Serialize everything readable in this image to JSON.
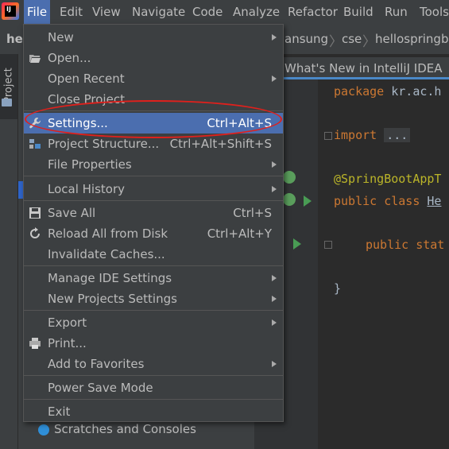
{
  "menubar": {
    "items": [
      "File",
      "Edit",
      "View",
      "Navigate",
      "Code",
      "Analyze",
      "Refactor",
      "Build",
      "Run",
      "Tools"
    ]
  },
  "breadcrumb": {
    "project": "hel",
    "parts": [
      "ansung",
      "cse",
      "hellospringbo"
    ]
  },
  "project_panel": {
    "tab_label": "Project",
    "scratches_label": "Scratches and Consoles"
  },
  "editor": {
    "tab_title": "What's New in IntelliJ IDEA",
    "lines": {
      "package_kw": "package",
      "package_name": " kr.ac.h",
      "import_kw": "import",
      "import_fold": "...",
      "annotation": "@SpringBootAppT",
      "public_kw": "public",
      "class_kw": "class",
      "class_name": "He",
      "public2_kw": "public",
      "static_kw": "stat",
      "brace": "}"
    }
  },
  "file_menu": {
    "items": [
      {
        "label": "New",
        "submenu": true
      },
      {
        "label": "Open...",
        "icon": "folder-open-icon"
      },
      {
        "label": "Open Recent",
        "submenu": true
      },
      {
        "label": "Close Project"
      },
      {
        "label": "Settings...",
        "shortcut": "Ctrl+Alt+S",
        "icon": "wrench-icon",
        "highlighted": true
      },
      {
        "label": "Project Structure...",
        "shortcut": "Ctrl+Alt+Shift+S",
        "icon": "project-structure-icon"
      },
      {
        "label": "File Properties",
        "submenu": true
      },
      {
        "label": "Local History",
        "submenu": true
      },
      {
        "label": "Save All",
        "shortcut": "Ctrl+S",
        "icon": "save-icon"
      },
      {
        "label": "Reload All from Disk",
        "shortcut": "Ctrl+Alt+Y",
        "icon": "reload-icon"
      },
      {
        "label": "Invalidate Caches..."
      },
      {
        "label": "Manage IDE Settings",
        "submenu": true
      },
      {
        "label": "New Projects Settings",
        "submenu": true
      },
      {
        "label": "Export",
        "submenu": true
      },
      {
        "label": "Print...",
        "icon": "print-icon"
      },
      {
        "label": "Add to Favorites",
        "submenu": true
      },
      {
        "label": "Power Save Mode"
      },
      {
        "label": "Exit"
      }
    ]
  },
  "colors": {
    "highlight": "#4b6eaf",
    "annotation_circle": "#e0201c",
    "keyword": "#cc7832"
  }
}
